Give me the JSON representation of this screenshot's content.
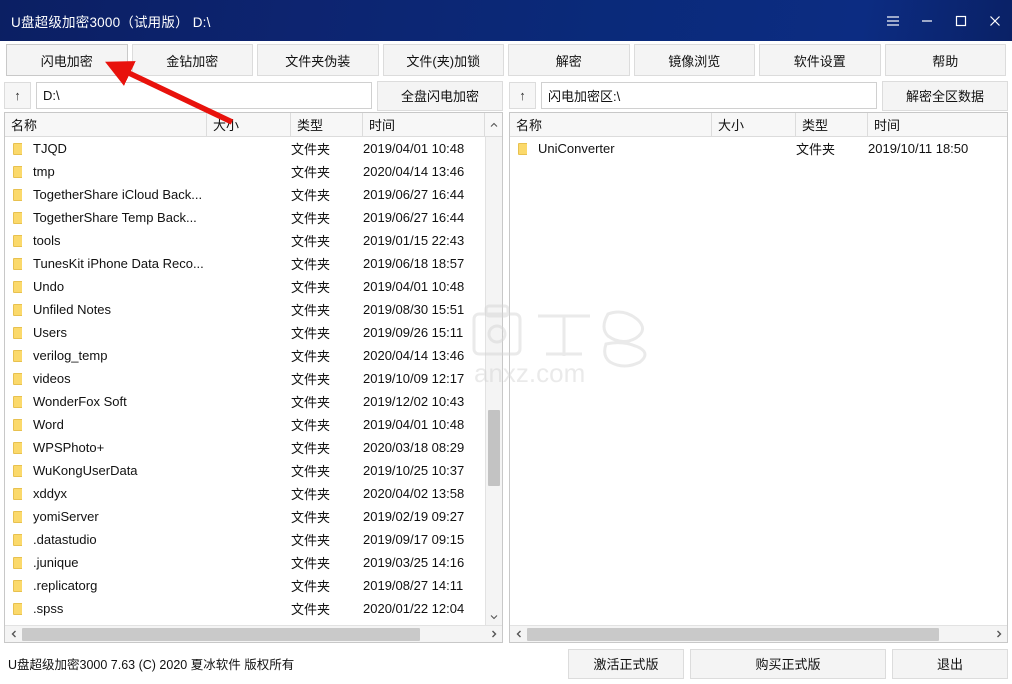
{
  "window": {
    "title": "U盘超级加密3000（试用版） D:\\",
    "controls": [
      {
        "name": "menu-icon",
        "label": "菜单"
      },
      {
        "name": "minimize-icon",
        "label": "最小化"
      },
      {
        "name": "maximize-icon",
        "label": "最大化"
      },
      {
        "name": "close-icon",
        "label": "关闭"
      }
    ]
  },
  "toolbar": {
    "buttons": [
      {
        "label": "闪电加密"
      },
      {
        "label": "金钻加密"
      },
      {
        "label": "文件夹伪装"
      },
      {
        "label": "文件(夹)加锁"
      },
      {
        "label": "解密"
      },
      {
        "label": "镜像浏览"
      },
      {
        "label": "软件设置"
      },
      {
        "label": "帮助"
      }
    ]
  },
  "pathbar": {
    "left": {
      "up_label": "↑",
      "path_value": "D:\\",
      "action_label": "全盘闪电加密"
    },
    "right": {
      "up_label": "↑",
      "path_value": "闪电加密区:\\",
      "action_label": "解密全区数据"
    }
  },
  "columns": {
    "name": "名称",
    "size": "大小",
    "type": "类型",
    "time": "时间"
  },
  "left_panel": {
    "rows": [
      {
        "name": "TJQD",
        "size": "",
        "type": "文件夹",
        "time": "2019/04/01 10:48"
      },
      {
        "name": "tmp",
        "size": "",
        "type": "文件夹",
        "time": "2020/04/14 13:46"
      },
      {
        "name": "TogetherShare iCloud Back...",
        "size": "",
        "type": "文件夹",
        "time": "2019/06/27 16:44"
      },
      {
        "name": "TogetherShare Temp Back...",
        "size": "",
        "type": "文件夹",
        "time": "2019/06/27 16:44"
      },
      {
        "name": "tools",
        "size": "",
        "type": "文件夹",
        "time": "2019/01/15 22:43"
      },
      {
        "name": "TunesKit iPhone Data Reco...",
        "size": "",
        "type": "文件夹",
        "time": "2019/06/18 18:57"
      },
      {
        "name": "Undo",
        "size": "",
        "type": "文件夹",
        "time": "2019/04/01 10:48"
      },
      {
        "name": "Unfiled Notes",
        "size": "",
        "type": "文件夹",
        "time": "2019/08/30 15:51"
      },
      {
        "name": "Users",
        "size": "",
        "type": "文件夹",
        "time": "2019/09/26 15:11"
      },
      {
        "name": "verilog_temp",
        "size": "",
        "type": "文件夹",
        "time": "2020/04/14 13:46"
      },
      {
        "name": "videos",
        "size": "",
        "type": "文件夹",
        "time": "2019/10/09 12:17"
      },
      {
        "name": "WonderFox Soft",
        "size": "",
        "type": "文件夹",
        "time": "2019/12/02 10:43"
      },
      {
        "name": "Word",
        "size": "",
        "type": "文件夹",
        "time": "2019/04/01 10:48"
      },
      {
        "name": "WPSPhoto+",
        "size": "",
        "type": "文件夹",
        "time": "2020/03/18 08:29"
      },
      {
        "name": "WuKongUserData",
        "size": "",
        "type": "文件夹",
        "time": "2019/10/25 10:37"
      },
      {
        "name": "xddyx",
        "size": "",
        "type": "文件夹",
        "time": "2020/04/02 13:58"
      },
      {
        "name": "yomiServer",
        "size": "",
        "type": "文件夹",
        "time": "2019/02/19 09:27"
      },
      {
        "name": ".datastudio",
        "size": "",
        "type": "文件夹",
        "time": "2019/09/17 09:15"
      },
      {
        "name": ".junique",
        "size": "",
        "type": "文件夹",
        "time": "2019/03/25 14:16"
      },
      {
        "name": ".replicatorg",
        "size": "",
        "type": "文件夹",
        "time": "2019/08/27 14:11"
      },
      {
        "name": ".spss",
        "size": "",
        "type": "文件夹",
        "time": "2020/01/22 12:04"
      }
    ]
  },
  "right_panel": {
    "rows": [
      {
        "name": "UniConverter",
        "size": "",
        "type": "文件夹",
        "time": "2019/10/11 18:50"
      }
    ]
  },
  "statusbar": {
    "text": "U盘超级加密3000 7.63 (C) 2020 夏冰软件 版权所有",
    "activate_label": "激活正式版",
    "buy_label": "购买正式版",
    "exit_label": "退出"
  },
  "watermark": {
    "line1": "安下载",
    "line2": "anxz.com"
  },
  "colors": {
    "titlebar": "#0b2472",
    "accent_arrow": "#e8120c",
    "folder": "#fbd96b",
    "button_face": "#f4f4f4"
  }
}
